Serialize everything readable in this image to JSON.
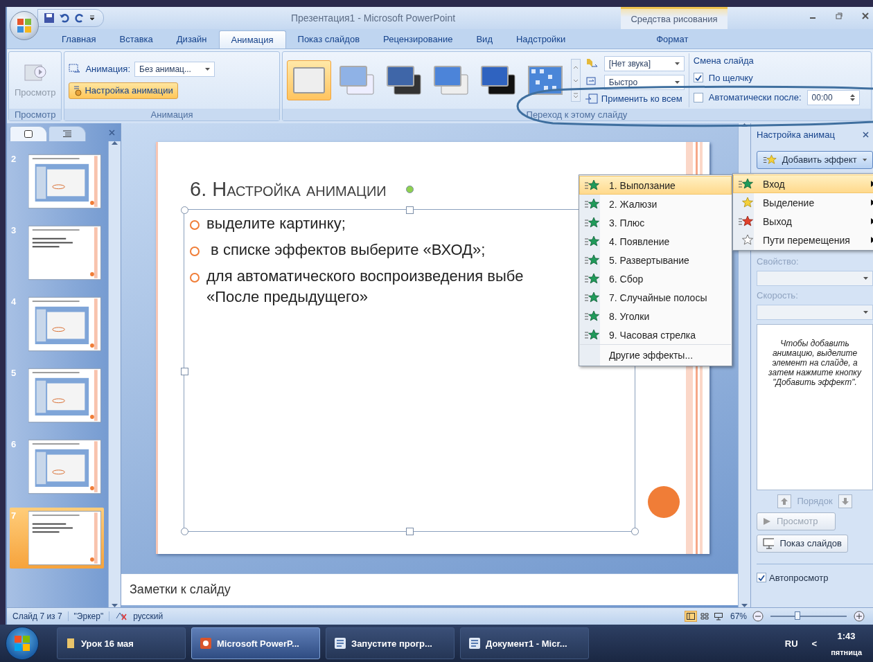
{
  "window": {
    "title": "Презентация1 - Microsoft PowerPoint",
    "context_group": "Средства рисования"
  },
  "ribbon_tabs": [
    {
      "label": "Главная",
      "selected": false,
      "kind": "main"
    },
    {
      "label": "Вставка",
      "selected": false,
      "kind": "main"
    },
    {
      "label": "Дизайн",
      "selected": false,
      "kind": "main"
    },
    {
      "label": "Анимация",
      "selected": true,
      "kind": "main"
    },
    {
      "label": "Показ слайдов",
      "selected": false,
      "kind": "main"
    },
    {
      "label": "Рецензирование",
      "selected": false,
      "kind": "main"
    },
    {
      "label": "Вид",
      "selected": false,
      "kind": "main"
    },
    {
      "label": "Надстройки",
      "selected": false,
      "kind": "main"
    },
    {
      "label": "Формат",
      "selected": false,
      "kind": "contextual"
    }
  ],
  "preview_group": {
    "button": "Просмотр",
    "label": "Просмотр"
  },
  "animation_group": {
    "field_label": "Анимация:",
    "value": "Без анимац...",
    "button": "Настройка анимации",
    "label": "Анимация"
  },
  "transition_group": {
    "label": "Переход к этому слайду",
    "transitions": [
      {
        "kind": "none",
        "selected": true
      },
      {
        "kind": "fade",
        "selected": false
      },
      {
        "kind": "dark",
        "selected": false
      },
      {
        "kind": "push",
        "selected": false
      },
      {
        "kind": "black",
        "selected": false
      },
      {
        "kind": "checker",
        "selected": false
      }
    ],
    "sound": "[Нет звука]",
    "speed": "Быстро",
    "apply_all": "Применить ко всем",
    "advance_title": "Смена слайда",
    "on_click": {
      "label": "По щелчку",
      "checked": true
    },
    "auto": {
      "label": "Автоматически после:",
      "checked": false,
      "value": "00:00"
    }
  },
  "slides_pane": {
    "tabs": [
      {
        "kind": "slides",
        "selected": true
      },
      {
        "kind": "outline",
        "selected": false
      }
    ],
    "thumbnails": [
      {
        "number": "2",
        "kind": "screenshot",
        "selected": false
      },
      {
        "number": "3",
        "kind": "text",
        "selected": false
      },
      {
        "number": "4",
        "kind": "screenshot",
        "selected": false
      },
      {
        "number": "5",
        "kind": "screenshot",
        "selected": false
      },
      {
        "number": "6",
        "kind": "screenshot",
        "selected": false
      },
      {
        "number": "7",
        "kind": "text",
        "selected": true
      }
    ]
  },
  "slide": {
    "title": "6. Настройка анимации",
    "bullets": [
      [
        "выделите картинку;"
      ],
      [
        " в списке эффектов выберите «ВХОД»;"
      ],
      [
        "для автоматического воспроизведения выбе",
        "«После предыдущего»"
      ]
    ]
  },
  "notes": {
    "placeholder": "Заметки к слайду"
  },
  "effects_menu": [
    {
      "label": "1. Выползание",
      "kind": "effect",
      "selected": true
    },
    {
      "label": "2. Жалюзи",
      "kind": "effect",
      "selected": false
    },
    {
      "label": "3. Плюс",
      "kind": "effect",
      "selected": false
    },
    {
      "label": "4. Появление",
      "kind": "effect",
      "selected": false
    },
    {
      "label": "5. Развертывание",
      "kind": "effect",
      "selected": false
    },
    {
      "label": "6. Сбор",
      "kind": "effect",
      "selected": false
    },
    {
      "label": "7. Случайные полосы",
      "kind": "effect",
      "selected": false
    },
    {
      "label": "8. Уголки",
      "kind": "effect",
      "selected": false
    },
    {
      "label": "9. Часовая стрелка",
      "kind": "effect",
      "selected": false
    },
    {
      "label": "Другие эффекты...",
      "kind": "more",
      "selected": false
    }
  ],
  "add_effect_menu": [
    {
      "label": "Вход",
      "kind": "entrance",
      "selected": true
    },
    {
      "label": "Выделение",
      "kind": "emphasis",
      "selected": false
    },
    {
      "label": "Выход",
      "kind": "exit",
      "selected": false
    },
    {
      "label": "Пути перемещения",
      "kind": "path",
      "selected": false
    }
  ],
  "task_pane": {
    "title": "Настройка анимац",
    "add_effect": "Добавить эффект",
    "property_label": "Свойство:",
    "speed_label": "Скорость:",
    "hint": "Чтобы добавить анимацию, выделите элемент на слайде, а затем нажмите кнопку \"Добавить эффект\".",
    "order_label": "Порядок",
    "preview": "Просмотр",
    "slideshow": "Показ слайдов",
    "autopreview": {
      "label": "Автопросмотр",
      "checked": true
    }
  },
  "status_bar": {
    "slide": "Слайд 7 из 7",
    "theme": "\"Эркер\"",
    "language": "русский",
    "views": [
      {
        "kind": "normal",
        "selected": true
      },
      {
        "kind": "sorter",
        "selected": false
      },
      {
        "kind": "show",
        "selected": false
      }
    ],
    "zoom": "67%",
    "level": 0.35
  },
  "taskbar": {
    "items": [
      {
        "label": "Урок 16 мая",
        "kind": "folder",
        "selected": false
      },
      {
        "label": "Microsoft PowerP...",
        "kind": "powerpoint",
        "selected": true
      },
      {
        "label": "Запустите прогр...",
        "kind": "word",
        "selected": false
      },
      {
        "label": "Документ1 - Micr...",
        "kind": "word",
        "selected": false
      }
    ],
    "language": "RU",
    "tray_toggle": "<",
    "time": "1:43",
    "day": "пятница"
  }
}
